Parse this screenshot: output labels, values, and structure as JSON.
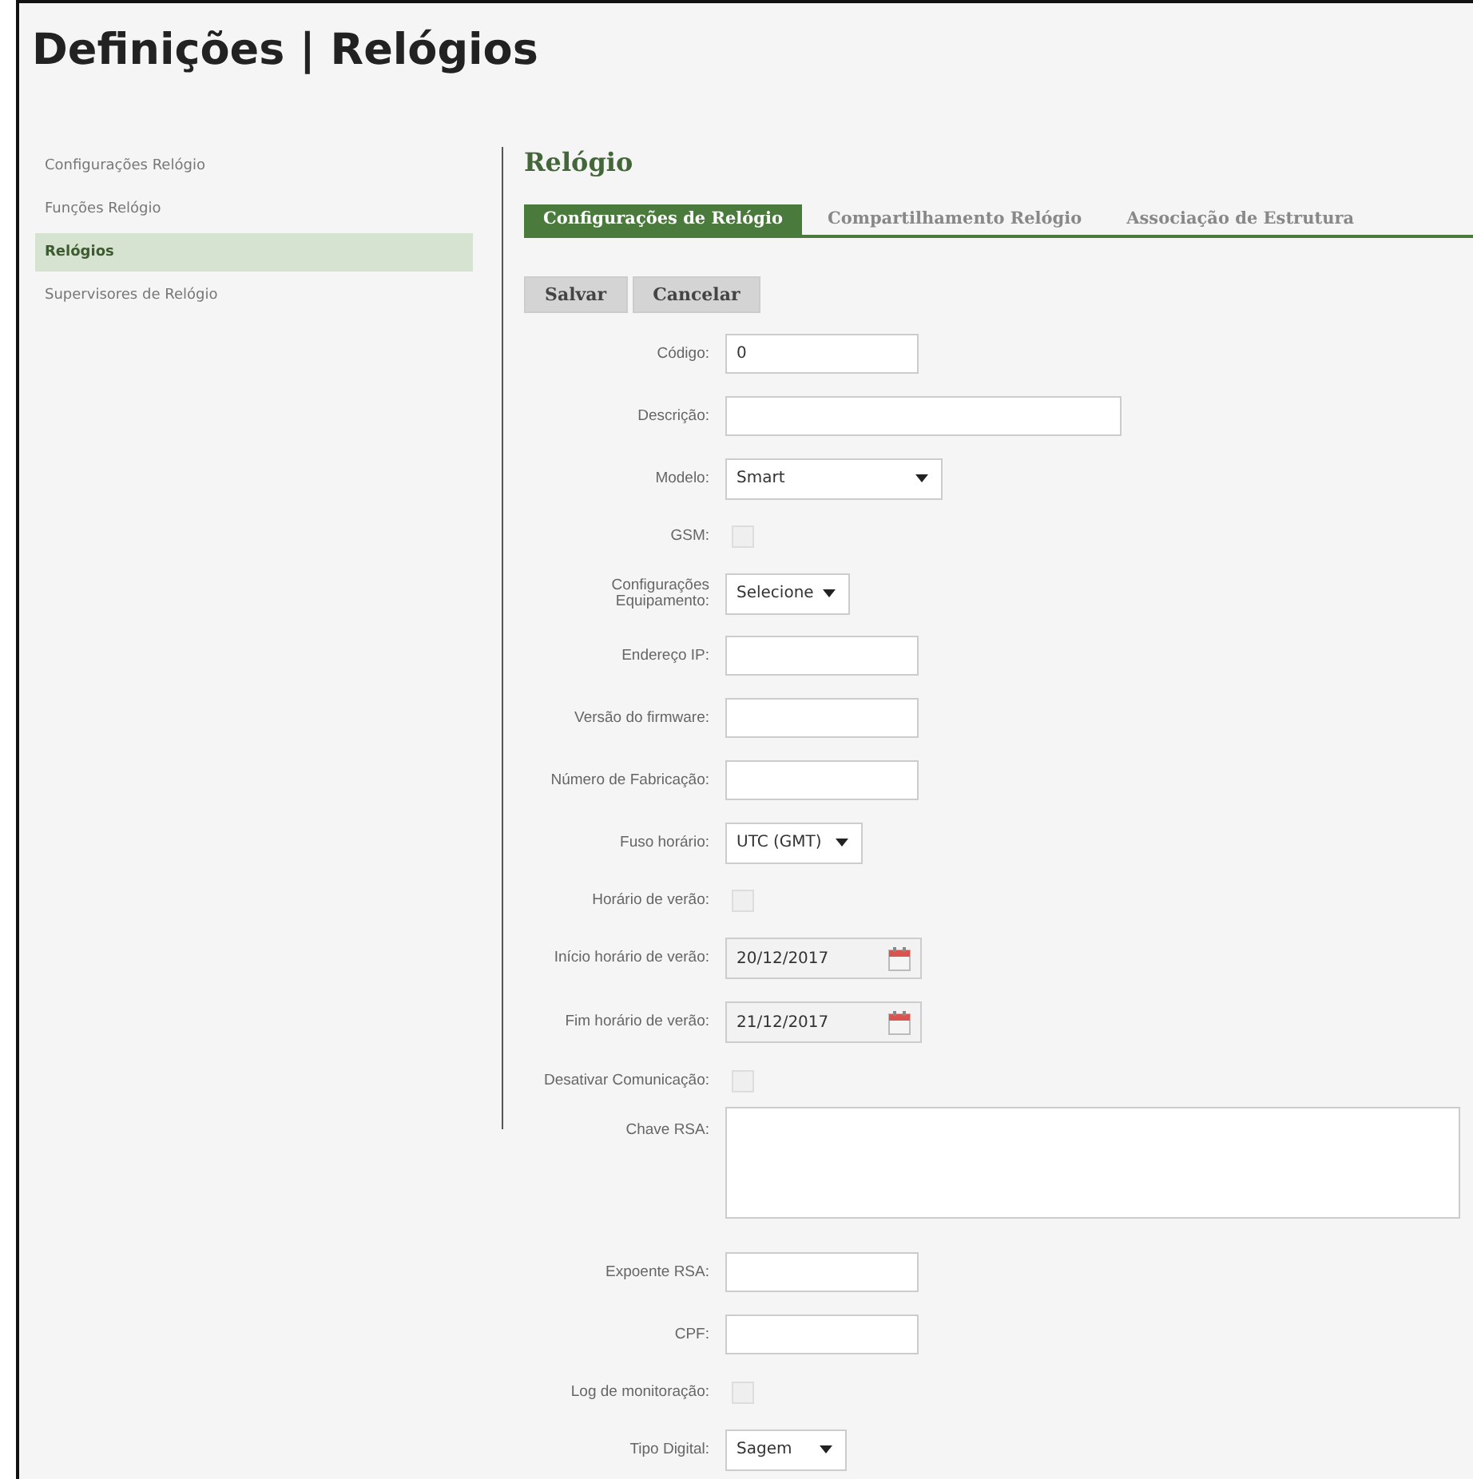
{
  "page_title": "Definições | Relógios",
  "sidebar": {
    "items": [
      {
        "label": "Configurações Relógio",
        "selected": false
      },
      {
        "label": "Funções Relógio",
        "selected": false
      },
      {
        "label": "Relógios",
        "selected": true
      },
      {
        "label": "Supervisores de Relógio",
        "selected": false
      }
    ]
  },
  "section_title": "Relógio",
  "tabs": [
    {
      "label": "Configurações de Relógio",
      "selected": true
    },
    {
      "label": "Compartilhamento Relógio",
      "selected": false
    },
    {
      "label": "Associação de Estrutura",
      "selected": false
    }
  ],
  "buttons": [
    "Salvar",
    "Cancelar"
  ],
  "form": [
    {
      "kind": "text",
      "label": "Código:",
      "value": "0"
    },
    {
      "kind": "text",
      "label": "Descrição:"
    },
    {
      "kind": "select",
      "label": "Modelo:",
      "value": "Smart"
    },
    {
      "kind": "checkbox",
      "label": "GSM:",
      "checked": false,
      "disabled": true
    },
    {
      "kind": "select",
      "label": "Configurações Equipamento:",
      "value": "Selecione"
    },
    {
      "kind": "text",
      "label": "Endereço IP:"
    },
    {
      "kind": "text",
      "label": "Versão do firmware:"
    },
    {
      "kind": "text",
      "label": "Número de Fabricação:"
    },
    {
      "kind": "select",
      "label": "Fuso horário:",
      "value": "UTC (GMT)"
    },
    {
      "kind": "checkbox",
      "label": "Horário de verão:",
      "checked": false,
      "disabled": true
    },
    {
      "kind": "date",
      "label": "Início horário de verão:",
      "value": "20/12/2017"
    },
    {
      "kind": "date",
      "label": "Fim horário de verão:",
      "value": "21/12/2017"
    },
    {
      "kind": "checkbox",
      "label": "Desativar Comunicação:",
      "checked": false,
      "disabled": true
    },
    {
      "kind": "textarea",
      "label": "Chave RSA:"
    },
    {
      "kind": "text",
      "label": "Expoente RSA:"
    },
    {
      "kind": "text",
      "label": "CPF:"
    },
    {
      "kind": "checkbox",
      "label": "Log de monitoração:",
      "checked": false,
      "disabled": true
    },
    {
      "kind": "select",
      "label": "Tipo Digital:",
      "value": "Sagem"
    }
  ]
}
